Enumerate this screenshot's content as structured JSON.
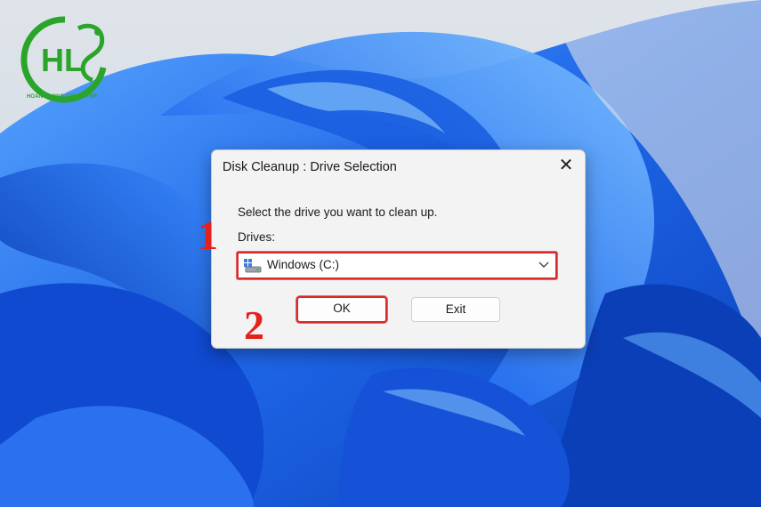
{
  "watermark": {
    "logo_letters": "HL",
    "brand_text": "HOANG LONG COMPUTER",
    "logo_color": "#2aa52a"
  },
  "dialog": {
    "title": "Disk Cleanup : Drive Selection",
    "close_icon": "close-icon",
    "prompt": "Select the drive you want to clean up.",
    "drives_label": "Drives:",
    "drive_select": {
      "selected_value": "Windows (C:)",
      "icon": "hard-drive-icon"
    },
    "ok_label": "OK",
    "exit_label": "Exit"
  },
  "annotations": {
    "step1": "1",
    "step2": "2",
    "highlight_color": "#d42a2a"
  },
  "wallpaper": {
    "style": "Windows 11 Bloom",
    "accent": "#2f6fe6"
  }
}
